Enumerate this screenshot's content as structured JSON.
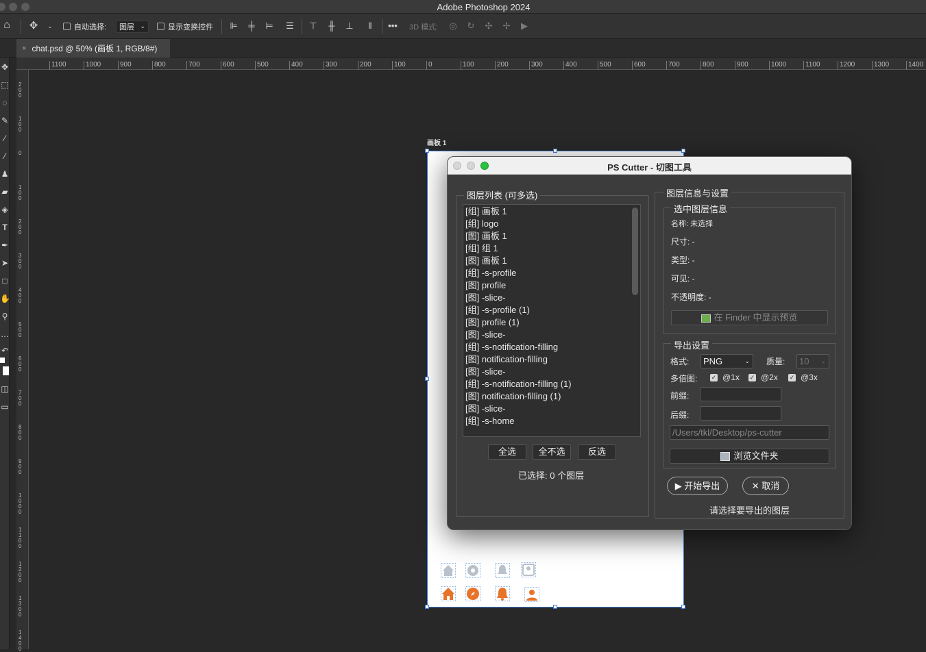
{
  "app": {
    "title": "Adobe Photoshop 2024"
  },
  "options_bar": {
    "auto_select_label": "自动选择:",
    "auto_select_value": "图层",
    "transform_controls_label": "显示变换控件",
    "mode_3d_label": "3D 模式:"
  },
  "document": {
    "tab_label": "chat.psd @ 50% (画板 1, RGB/8#)"
  },
  "ruler": {
    "h_ticks": [
      "1100",
      "1000",
      "900",
      "800",
      "700",
      "600",
      "500",
      "400",
      "300",
      "200",
      "100",
      "0",
      "100",
      "200",
      "300",
      "400",
      "500",
      "600",
      "700",
      "800",
      "900",
      "1000",
      "1100",
      "1200",
      "1300",
      "1400"
    ],
    "v_ticks": [
      "200",
      "100",
      "0",
      "100",
      "200",
      "300",
      "400",
      "500",
      "600",
      "700",
      "800",
      "900",
      "1000",
      "1100",
      "1200",
      "1300",
      "1400"
    ]
  },
  "artboard": {
    "label": "画板 1"
  },
  "dialog": {
    "title": "PS Cutter - 切图工具",
    "layer_list": {
      "legend": "图层列表 (可多选)",
      "items": [
        "[组] 画板 1",
        "[组] logo",
        "[图] 画板 1",
        "[组] 组 1",
        "[图] 画板 1",
        "[组] -s-profile",
        "[图] profile",
        "[图] -slice-",
        "[组] -s-profile (1)",
        "[图] profile (1)",
        "[图] -slice-",
        "[组] -s-notification-filling",
        "[图] notification-filling",
        "[图] -slice-",
        "[组] -s-notification-filling (1)",
        "[图] notification-filling (1)",
        "[图] -slice-",
        "[组] -s-home"
      ],
      "select_all": "全选",
      "select_none": "全不选",
      "invert": "反选",
      "selected_count": "已选择: 0 个图层"
    },
    "info_panel": {
      "legend": "图层信息与设置",
      "selected_legend": "选中图层信息",
      "name": "名称: 未选择",
      "size": "尺寸: -",
      "type": "类型: -",
      "visible": "可见: -",
      "opacity": "不透明度: -",
      "preview_button": "在 Finder 中显示预览"
    },
    "export_settings": {
      "legend": "导出设置",
      "format_label": "格式:",
      "format_value": "PNG",
      "quality_label": "质量:",
      "quality_value": "10",
      "scale_label": "多倍图:",
      "scale_1x": "@1x",
      "scale_2x": "@2x",
      "scale_3x": "@3x",
      "prefix_label": "前缀:",
      "suffix_label": "后缀:",
      "path_placeholder": "/Users/tkl/Desktop/ps-cutter",
      "browse_button": "浏览文件夹"
    },
    "start_button": "▶ 开始导出",
    "cancel_button": "✕ 取消",
    "status": "请选择要导出的图层"
  },
  "colors": {
    "accent": "#e8742a",
    "selection": "#3b7ad8"
  }
}
